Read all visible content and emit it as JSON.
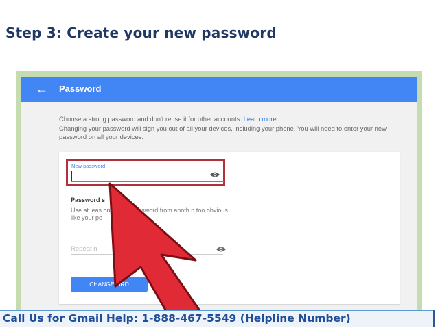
{
  "slide": {
    "title": "Step 3: Create your new password",
    "footer": "Call Us for Gmail Help: 1-888-467-5549 (Helpline Number)"
  },
  "appbar": {
    "title": "Password",
    "back_icon": "arrow-left-icon",
    "color": "#4285f4"
  },
  "intro": {
    "line1": "Choose a strong password and don't reuse it for other accounts.",
    "learn_more": "Learn more.",
    "line2": "Changing your password will sign you out of all your devices, including your phone. You will need to enter your new password on all your devices."
  },
  "form": {
    "new_password_label": "New password",
    "new_password_value": "",
    "visibility_icon": "eye-icon",
    "strength_title": "Password s",
    "strength_hint": "Use at leas     on't use a password from anoth       n too obvious like your pe",
    "repeat_placeholder": "Repeat n",
    "submit_label": "CHANGE          ORD"
  },
  "overlay": {
    "pointer_icon": "red-pointer-arrow-icon",
    "highlight_color": "#b0313c",
    "arrow_color": "#e02b36"
  }
}
